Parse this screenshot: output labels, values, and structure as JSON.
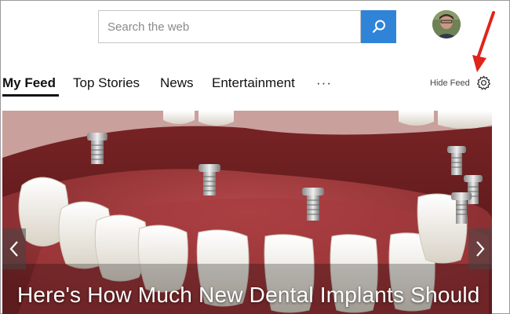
{
  "search": {
    "placeholder": "Search the web"
  },
  "tabs": [
    {
      "label": "My Feed"
    },
    {
      "label": "Top Stories"
    },
    {
      "label": "News"
    },
    {
      "label": "Entertainment"
    }
  ],
  "more_label": "···",
  "hide_feed_label": "Hide Feed",
  "hero": {
    "headline": "Here's How Much New Dental Implants Should",
    "prev_icon": "chevron-left-icon",
    "next_icon": "chevron-right-icon"
  },
  "colors": {
    "accent": "#2f84d8",
    "annotation": "#e0241c",
    "gum": "#8e2d2f",
    "tooth": "#f2eee6"
  }
}
